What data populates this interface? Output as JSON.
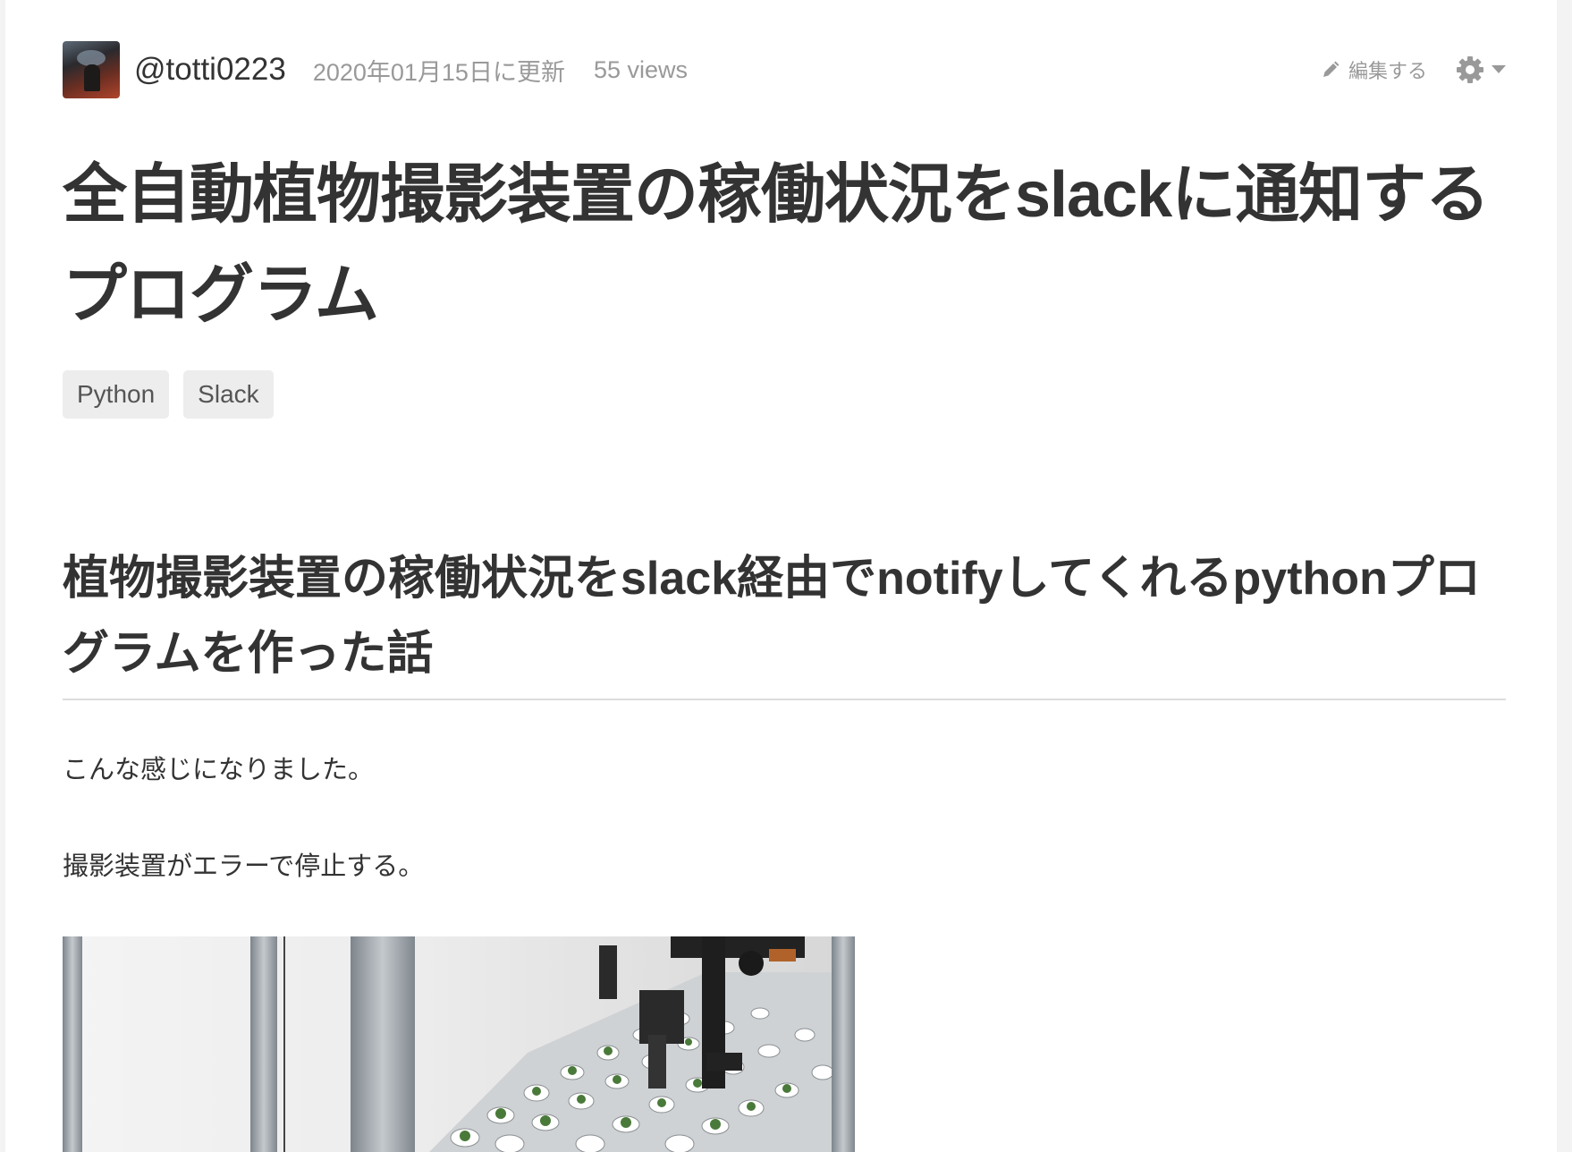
{
  "author": {
    "username": "@totti0223"
  },
  "meta": {
    "updated": "2020年01月15日に更新",
    "views": "55 views"
  },
  "actions": {
    "edit_label": "編集する"
  },
  "article": {
    "title": "全自動植物撮影装置の稼働状況をslackに通知するプログラム",
    "tags": [
      "Python",
      "Slack"
    ],
    "heading": "植物撮影装置の稼働状況をslack経由でnotifyしてくれるpythonプログラムを作った話",
    "paragraphs": [
      "こんな感じになりました。",
      "撮影装置がエラーで停止する。"
    ]
  },
  "colors": {
    "text": "#333333",
    "muted": "#999999",
    "tag_bg": "#ededed",
    "rule": "#dddddd"
  },
  "icons": {
    "edit": "pencil-icon",
    "settings": "gear-icon",
    "dropdown": "caret-down-icon"
  }
}
